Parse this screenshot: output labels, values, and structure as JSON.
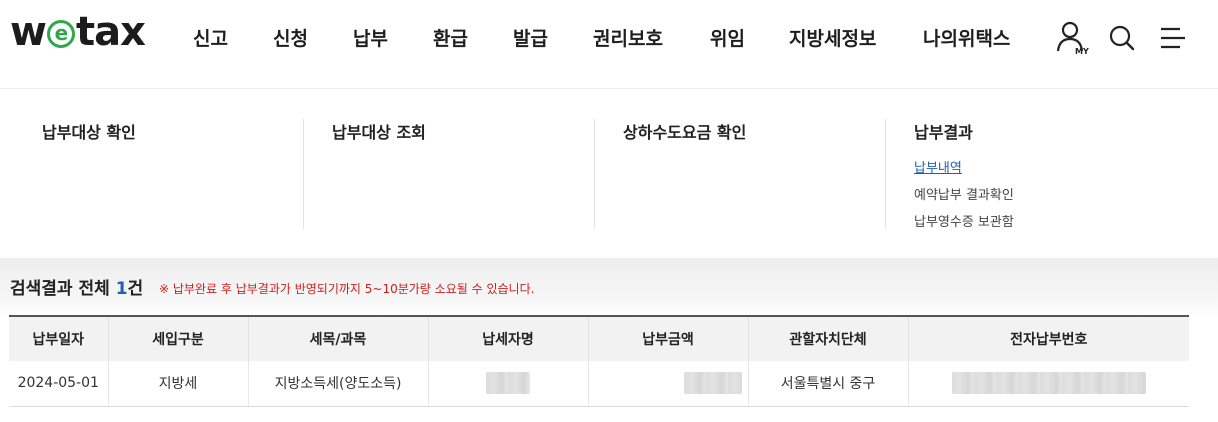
{
  "header": {
    "logo": {
      "prefix": "w",
      "e_letter": "e",
      "suffix": "tax",
      "brand_color": "#2da84a"
    },
    "gnb": [
      {
        "label": "신고"
      },
      {
        "label": "신청"
      },
      {
        "label": "납부"
      },
      {
        "label": "환급"
      },
      {
        "label": "발급"
      },
      {
        "label": "권리보호"
      },
      {
        "label": "위임"
      },
      {
        "label": "지방세정보"
      },
      {
        "label": "나의위택스"
      }
    ],
    "utils": {
      "my_label": "MY",
      "icons": [
        "my-page-icon",
        "search-icon",
        "menu-icon"
      ]
    }
  },
  "mega_menu": {
    "columns": [
      {
        "title": "납부대상 확인",
        "items": []
      },
      {
        "title": "납부대상 조회",
        "items": []
      },
      {
        "title": "상하수도요금 확인",
        "items": []
      },
      {
        "title": "납부결과",
        "items": [
          "납부내역",
          "예약납부 결과확인",
          "납부영수증 보관함"
        ],
        "active_item": "납부내역"
      }
    ]
  },
  "result": {
    "title_prefix": "검색결과 전체 ",
    "count": "1",
    "title_suffix": "건",
    "notice": "※ 납부완료 후 납부결과가 반영되기까지 5~10분가량 소요될 수 있습니다.",
    "accent_color": "#1f5fb4",
    "notice_color": "#cc1f1f"
  },
  "table": {
    "columns": [
      "납부일자",
      "세입구분",
      "세목/과목",
      "납세자명",
      "납부금액",
      "관할자치단체",
      "전자납부번호"
    ],
    "rows": [
      {
        "date": "2024-05-01",
        "category": "지방세",
        "tax_item": "지방소득세(양도소득)",
        "taxpayer": "",
        "amount": "",
        "authority": "서울특별시 중구",
        "payment_no": ""
      }
    ]
  }
}
